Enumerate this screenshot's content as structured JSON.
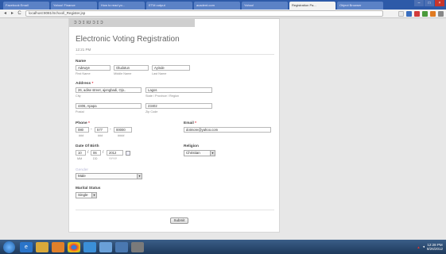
{
  "browser": {
    "tabs": [
      {
        "label": "Facebook Email",
        "active": false
      },
      {
        "label": "Yahoo! Finance",
        "active": false
      },
      {
        "label": "How to read yo...",
        "active": false
      },
      {
        "label": "ETM output",
        "active": false
      },
      {
        "label": "acadent.com",
        "active": false
      },
      {
        "label": "Yahoo!",
        "active": false
      },
      {
        "label": "Registration Pa...",
        "active": true
      },
      {
        "label": "Object Browser",
        "active": false
      }
    ],
    "url": "localhost:8081/School/_Register.jsp",
    "nav": {
      "back": "◂",
      "forward": "▸",
      "reload": "C"
    },
    "window_buttons": {
      "minimize": "–",
      "maximize": "□",
      "close": "×"
    }
  },
  "page": {
    "header_strip": "ɔ ɔ ɪ ıʊ ɔ ɪ ɔ",
    "title": "Electronic Voting Registration",
    "time": "12:21 PM",
    "name": {
      "label": "Name",
      "first_value": "Adewye",
      "middle_value": "Oludotun",
      "last_value": "Ayinde",
      "first_sub": "First Name",
      "middle_sub": "Middle Name",
      "last_sub": "Last Name"
    },
    "address": {
      "label": "Address",
      "required": "*",
      "street_value": "26, adise street, ajengbadi, Ojo..",
      "city_sub": "City",
      "state_value": "Lagos",
      "state_sub": "State / Province / Region",
      "postal_value": "4406, Apapa",
      "postal_sub": "Postal",
      "zip_value": "23402",
      "zip_sub": "Zip Code"
    },
    "phone": {
      "label": "Phone",
      "required": "*",
      "part1": "080",
      "part2": "577",
      "part3": "00000",
      "sub1": "###",
      "sub2": "###",
      "sub3": "####",
      "dash": "-"
    },
    "email": {
      "label": "Email",
      "required": "*",
      "value": "dotmore@yahoo.com"
    },
    "dob": {
      "label": "Date Of Birth",
      "mm": "10",
      "dd": "06",
      "yyyy": "2012",
      "mm_sub": "MM",
      "dd_sub": "DD",
      "yyyy_sub": "YYYY",
      "slash": "/"
    },
    "religion": {
      "label": "Religion",
      "selected": "Christian"
    },
    "gender": {
      "label": "Gender",
      "selected": "Male"
    },
    "marital": {
      "label": "Marital Status",
      "selected": "Single"
    },
    "submit_label": "Submit"
  },
  "taskbar": {
    "time": "12:28 PM",
    "date": "8/26/2012"
  },
  "colors": {
    "tabbar": "#2d5aa8",
    "required": "#dd2233",
    "close": "#c8352b"
  }
}
